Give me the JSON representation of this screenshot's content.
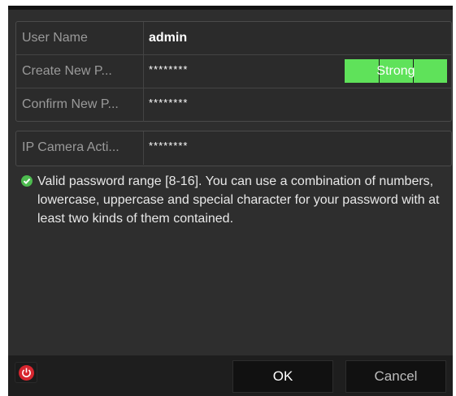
{
  "form": {
    "user_name": {
      "label": "User Name",
      "value": "admin"
    },
    "create_password": {
      "label": "Create New P...",
      "value": "********"
    },
    "strength": {
      "label": "Strong"
    },
    "confirm_password": {
      "label": "Confirm New P...",
      "value": "********"
    },
    "ip_camera": {
      "label": "IP Camera Acti...",
      "value": "********"
    }
  },
  "hint": {
    "icon": "check-circle-icon",
    "text": "Valid password range [8-16]. You can use a combination of numbers, lowercase, uppercase and special character for your password with at least two kinds of them contained."
  },
  "footer": {
    "power_icon": "power-icon",
    "ok_label": "OK",
    "cancel_label": "Cancel"
  },
  "colors": {
    "strength_bar": "#5fe25a",
    "check_icon": "#4dbb4f",
    "power_icon": "#d7262f"
  }
}
